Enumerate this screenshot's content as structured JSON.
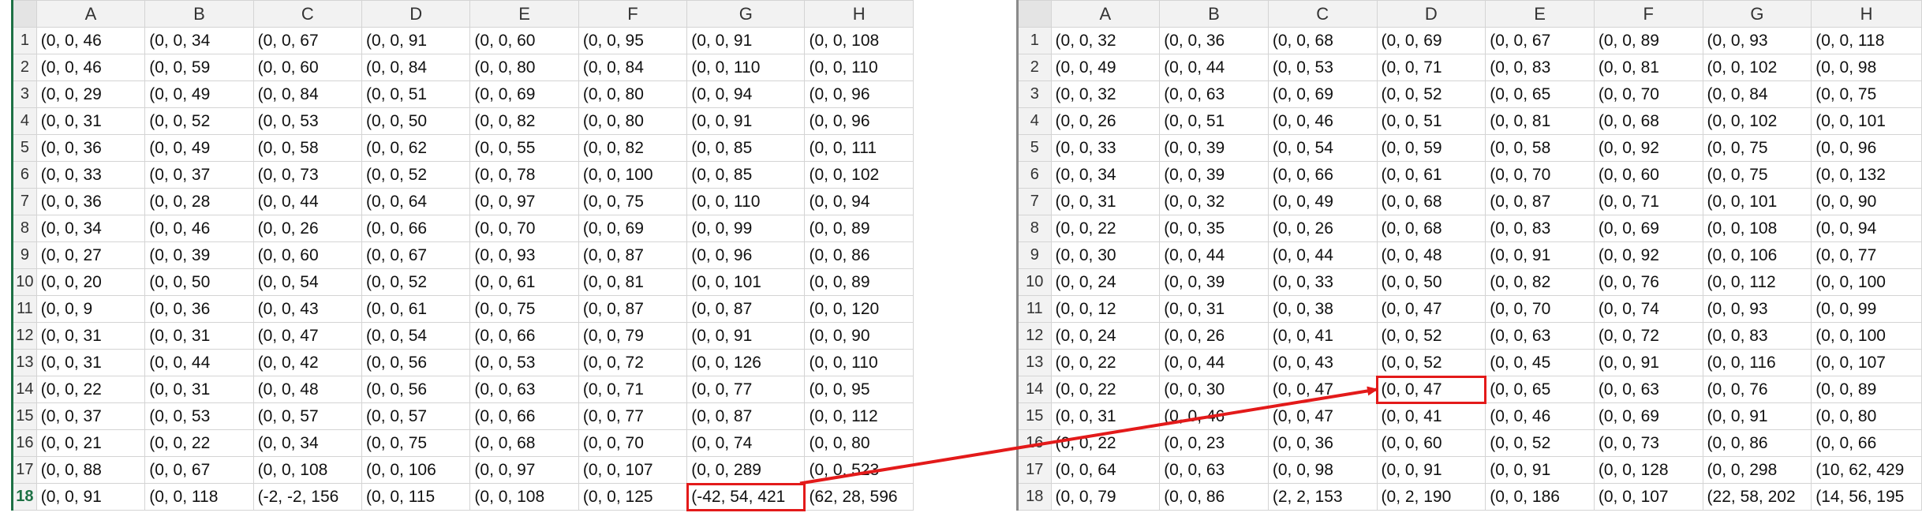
{
  "columns": [
    "A",
    "B",
    "C",
    "D",
    "E",
    "F",
    "G",
    "H"
  ],
  "left_sheet": {
    "rows": [
      {
        "num": "1",
        "cells": [
          "(0, 0, 46",
          "(0, 0, 34",
          "(0, 0, 67",
          "(0, 0, 91",
          "(0, 0, 60",
          "(0, 0, 95",
          "(0, 0, 91",
          "(0, 0, 108"
        ]
      },
      {
        "num": "2",
        "cells": [
          "(0, 0, 46",
          "(0, 0, 59",
          "(0, 0, 60",
          "(0, 0, 84",
          "(0, 0, 80",
          "(0, 0, 84",
          "(0, 0, 110",
          "(0, 0, 110"
        ]
      },
      {
        "num": "3",
        "cells": [
          "(0, 0, 29",
          "(0, 0, 49",
          "(0, 0, 84",
          "(0, 0, 51",
          "(0, 0, 69",
          "(0, 0, 80",
          "(0, 0, 94",
          "(0, 0, 96"
        ]
      },
      {
        "num": "4",
        "cells": [
          "(0, 0, 31",
          "(0, 0, 52",
          "(0, 0, 53",
          "(0, 0, 50",
          "(0, 0, 82",
          "(0, 0, 80",
          "(0, 0, 91",
          "(0, 0, 96"
        ]
      },
      {
        "num": "5",
        "cells": [
          "(0, 0, 36",
          "(0, 0, 49",
          "(0, 0, 58",
          "(0, 0, 62",
          "(0, 0, 55",
          "(0, 0, 82",
          "(0, 0, 85",
          "(0, 0, 111"
        ]
      },
      {
        "num": "6",
        "cells": [
          "(0, 0, 33",
          "(0, 0, 37",
          "(0, 0, 73",
          "(0, 0, 52",
          "(0, 0, 78",
          "(0, 0, 100",
          "(0, 0, 85",
          "(0, 0, 102"
        ]
      },
      {
        "num": "7",
        "cells": [
          "(0, 0, 36",
          "(0, 0, 28",
          "(0, 0, 44",
          "(0, 0, 64",
          "(0, 0, 97",
          "(0, 0, 75",
          "(0, 0, 110",
          "(0, 0, 94"
        ]
      },
      {
        "num": "8",
        "cells": [
          "(0, 0, 34",
          "(0, 0, 46",
          "(0, 0, 26",
          "(0, 0, 66",
          "(0, 0, 70",
          "(0, 0, 69",
          "(0, 0, 99",
          "(0, 0, 89"
        ]
      },
      {
        "num": "9",
        "cells": [
          "(0, 0, 27",
          "(0, 0, 39",
          "(0, 0, 60",
          "(0, 0, 67",
          "(0, 0, 93",
          "(0, 0, 87",
          "(0, 0, 96",
          "(0, 0, 86"
        ]
      },
      {
        "num": "10",
        "cells": [
          "(0, 0, 20",
          "(0, 0, 50",
          "(0, 0, 54",
          "(0, 0, 52",
          "(0, 0, 61",
          "(0, 0, 81",
          "(0, 0, 101",
          "(0, 0, 89"
        ]
      },
      {
        "num": "11",
        "cells": [
          "(0, 0, 9",
          "(0, 0, 36",
          "(0, 0, 43",
          "(0, 0, 61",
          "(0, 0, 75",
          "(0, 0, 87",
          "(0, 0, 87",
          "(0, 0, 120"
        ]
      },
      {
        "num": "12",
        "cells": [
          "(0, 0, 31",
          "(0, 0, 31",
          "(0, 0, 47",
          "(0, 0, 54",
          "(0, 0, 66",
          "(0, 0, 79",
          "(0, 0, 91",
          "(0, 0, 90"
        ]
      },
      {
        "num": "13",
        "cells": [
          "(0, 0, 31",
          "(0, 0, 44",
          "(0, 0, 42",
          "(0, 0, 56",
          "(0, 0, 53",
          "(0, 0, 72",
          "(0, 0, 126",
          "(0, 0, 110"
        ]
      },
      {
        "num": "14",
        "cells": [
          "(0, 0, 22",
          "(0, 0, 31",
          "(0, 0, 48",
          "(0, 0, 56",
          "(0, 0, 63",
          "(0, 0, 71",
          "(0, 0, 77",
          "(0, 0, 95"
        ]
      },
      {
        "num": "15",
        "cells": [
          "(0, 0, 37",
          "(0, 0, 53",
          "(0, 0, 57",
          "(0, 0, 57",
          "(0, 0, 66",
          "(0, 0, 77",
          "(0, 0, 87",
          "(0, 0, 112"
        ]
      },
      {
        "num": "16",
        "cells": [
          "(0, 0, 21",
          "(0, 0, 22",
          "(0, 0, 34",
          "(0, 0, 75",
          "(0, 0, 68",
          "(0, 0, 70",
          "(0, 0, 74",
          "(0, 0, 80"
        ]
      },
      {
        "num": "17",
        "cells": [
          "(0, 0, 88",
          "(0, 0, 67",
          "(0, 0, 108",
          "(0, 0, 106",
          "(0, 0, 97",
          "(0, 0, 107",
          "(0, 0, 289",
          "(0, 0, 523"
        ]
      },
      {
        "num": "18",
        "cells": [
          "(0, 0, 91",
          "(0, 0, 118",
          "(-2, -2, 156",
          "(0, 0, 115",
          "(0, 0, 108",
          "(0, 0, 125",
          "(-42, 54, 421",
          "(62, 28, 596"
        ]
      }
    ]
  },
  "right_sheet": {
    "rows": [
      {
        "num": "1",
        "cells": [
          "(0, 0, 32",
          "(0, 0, 36",
          "(0, 0, 68",
          "(0, 0, 69",
          "(0, 0, 67",
          "(0, 0, 89",
          "(0, 0, 93",
          "(0, 0, 118"
        ]
      },
      {
        "num": "2",
        "cells": [
          "(0, 0, 49",
          "(0, 0, 44",
          "(0, 0, 53",
          "(0, 0, 71",
          "(0, 0, 83",
          "(0, 0, 81",
          "(0, 0, 102",
          "(0, 0, 98"
        ]
      },
      {
        "num": "3",
        "cells": [
          "(0, 0, 32",
          "(0, 0, 63",
          "(0, 0, 69",
          "(0, 0, 52",
          "(0, 0, 65",
          "(0, 0, 70",
          "(0, 0, 84",
          "(0, 0, 75"
        ]
      },
      {
        "num": "4",
        "cells": [
          "(0, 0, 26",
          "(0, 0, 51",
          "(0, 0, 46",
          "(0, 0, 51",
          "(0, 0, 81",
          "(0, 0, 68",
          "(0, 0, 102",
          "(0, 0, 101"
        ]
      },
      {
        "num": "5",
        "cells": [
          "(0, 0, 33",
          "(0, 0, 39",
          "(0, 0, 54",
          "(0, 0, 59",
          "(0, 0, 58",
          "(0, 0, 92",
          "(0, 0, 75",
          "(0, 0, 96"
        ]
      },
      {
        "num": "6",
        "cells": [
          "(0, 0, 34",
          "(0, 0, 39",
          "(0, 0, 66",
          "(0, 0, 61",
          "(0, 0, 70",
          "(0, 0, 60",
          "(0, 0, 75",
          "(0, 0, 132"
        ]
      },
      {
        "num": "7",
        "cells": [
          "(0, 0, 31",
          "(0, 0, 32",
          "(0, 0, 49",
          "(0, 0, 68",
          "(0, 0, 87",
          "(0, 0, 71",
          "(0, 0, 101",
          "(0, 0, 90"
        ]
      },
      {
        "num": "8",
        "cells": [
          "(0, 0, 22",
          "(0, 0, 35",
          "(0, 0, 26",
          "(0, 0, 68",
          "(0, 0, 83",
          "(0, 0, 69",
          "(0, 0, 108",
          "(0, 0, 94"
        ]
      },
      {
        "num": "9",
        "cells": [
          "(0, 0, 30",
          "(0, 0, 44",
          "(0, 0, 44",
          "(0, 0, 48",
          "(0, 0, 91",
          "(0, 0, 92",
          "(0, 0, 106",
          "(0, 0, 77"
        ]
      },
      {
        "num": "10",
        "cells": [
          "(0, 0, 24",
          "(0, 0, 39",
          "(0, 0, 33",
          "(0, 0, 50",
          "(0, 0, 82",
          "(0, 0, 76",
          "(0, 0, 112",
          "(0, 0, 100"
        ]
      },
      {
        "num": "11",
        "cells": [
          "(0, 0, 12",
          "(0, 0, 31",
          "(0, 0, 38",
          "(0, 0, 47",
          "(0, 0, 70",
          "(0, 0, 74",
          "(0, 0, 93",
          "(0, 0, 99"
        ]
      },
      {
        "num": "12",
        "cells": [
          "(0, 0, 24",
          "(0, 0, 26",
          "(0, 0, 41",
          "(0, 0, 52",
          "(0, 0, 63",
          "(0, 0, 72",
          "(0, 0, 83",
          "(0, 0, 100"
        ]
      },
      {
        "num": "13",
        "cells": [
          "(0, 0, 22",
          "(0, 0, 44",
          "(0, 0, 43",
          "(0, 0, 52",
          "(0, 0, 45",
          "(0, 0, 91",
          "(0, 0, 116",
          "(0, 0, 107"
        ]
      },
      {
        "num": "14",
        "cells": [
          "(0, 0, 22",
          "(0, 0, 30",
          "(0, 0, 47",
          "(0, 0, 47",
          "(0, 0, 65",
          "(0, 0, 63",
          "(0, 0, 76",
          "(0, 0, 89"
        ]
      },
      {
        "num": "15",
        "cells": [
          "(0, 0, 31",
          "(0, 0, 46",
          "(0, 0, 47",
          "(0, 0, 41",
          "(0, 0, 46",
          "(0, 0, 69",
          "(0, 0, 91",
          "(0, 0, 80"
        ]
      },
      {
        "num": "16",
        "cells": [
          "(0, 0, 22",
          "(0, 0, 23",
          "(0, 0, 36",
          "(0, 0, 60",
          "(0, 0, 52",
          "(0, 0, 73",
          "(0, 0, 86",
          "(0, 0, 66"
        ]
      },
      {
        "num": "17",
        "cells": [
          "(0, 0, 64",
          "(0, 0, 63",
          "(0, 0, 98",
          "(0, 0, 91",
          "(0, 0, 91",
          "(0, 0, 128",
          "(0, 0, 298",
          "(10, 62, 429"
        ]
      },
      {
        "num": "18",
        "cells": [
          "(0, 0, 79",
          "(0, 0, 86",
          "(2, 2, 153",
          "(0, 2, 190",
          "(0, 0, 186",
          "(0, 0, 107",
          "(22, 58, 202",
          "(14, 56, 195"
        ]
      }
    ]
  },
  "annotation": {
    "from_cell": "left G18",
    "to_cell": "right D14",
    "color": "#e31a1a"
  },
  "colors": {
    "header_bg": "#f2f2f2",
    "grid": "#d4d4d4",
    "active_row": "#1e7145"
  }
}
